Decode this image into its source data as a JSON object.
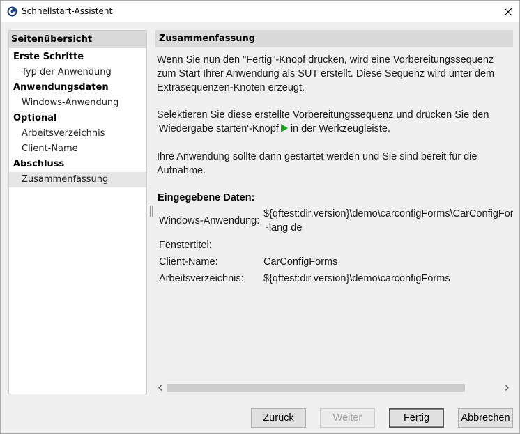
{
  "window": {
    "title": "Schnellstart-Assistent",
    "icon": "qftest-app-icon",
    "close_icon": "close-icon"
  },
  "nav": {
    "header": "Seitenübersicht",
    "items": [
      {
        "label": "Erste Schritte",
        "type": "group"
      },
      {
        "label": "Typ der Anwendung",
        "type": "sub"
      },
      {
        "label": "Anwendungsdaten",
        "type": "group"
      },
      {
        "label": "Windows-Anwendung",
        "type": "sub"
      },
      {
        "label": "Optional",
        "type": "group"
      },
      {
        "label": "Arbeitsverzeichnis",
        "type": "sub"
      },
      {
        "label": "Client-Name",
        "type": "sub"
      },
      {
        "label": "Abschluss",
        "type": "group"
      },
      {
        "label": "Zusammenfassung",
        "type": "sub",
        "selected": true
      }
    ]
  },
  "content": {
    "header": "Zusammenfassung",
    "para1": "Wenn Sie nun den \"Fertig\"-Knopf drücken, wird eine Vorbereitungssequenz zum Start Ihrer Anwendung als SUT erstellt. Diese Sequenz wird unter dem Extrasequenzen-Knoten erzeugt.",
    "para2_before": "Selektieren Sie diese erstellte Vorbereitungssequenz und drücken Sie den 'Wiedergabe starten'-Knopf",
    "para2_after": "in der Werkzeugleiste.",
    "play_icon": "play-icon",
    "play_color": "#1aa01a",
    "para3": "Ihre Anwendung sollte dann gestartet werden und Sie sind bereit für die Aufnahme.",
    "data_heading": "Eingegebene Daten:",
    "rows": [
      {
        "label": "Windows-Anwendung:",
        "value": "${qftest:dir.version}\\demo\\carconfigForms\\CarConfigForms.exe",
        "value2": "-lang de"
      },
      {
        "label": "Fenstertitel:",
        "value": ""
      },
      {
        "label": "Client-Name:",
        "value": "CarConfigForms"
      },
      {
        "label": "Arbeitsverzeichnis:",
        "value": "${qftest:dir.version}\\demo\\carconfigForms"
      }
    ]
  },
  "buttons": {
    "back": "Zurück",
    "next": "Weiter",
    "finish": "Fertig",
    "cancel": "Abbrechen"
  }
}
